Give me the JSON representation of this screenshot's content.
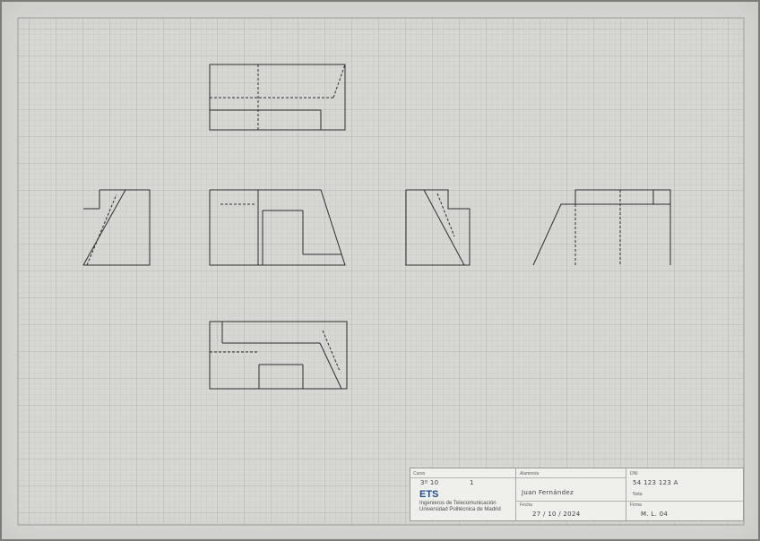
{
  "sheet": {
    "description": "Graph-paper engineering drawing sheet with orthographic projections"
  },
  "title_block": {
    "col1": {
      "header": "Curso",
      "field_1": "3º 10",
      "field_2": "1",
      "brand": "ETS",
      "school_line_1": "Ingenieros de Telecomunicación",
      "school_line_2": "Universidad Politécnica de Madrid"
    },
    "col2": {
      "header": "Alumno/a",
      "name": "Juan Fernández",
      "date_label": "Fecha",
      "date_value": "27 / 10 / 2024"
    },
    "col3": {
      "header": "DNI",
      "dni_value": "54 123 123 A",
      "grade_label": "Nota",
      "signature_label": "Firma",
      "signature_value": "M. L. 04"
    }
  }
}
